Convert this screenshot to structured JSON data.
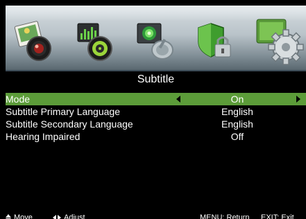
{
  "menu_icons": [
    {
      "name": "picture-icon",
      "active": false
    },
    {
      "name": "sound-icon",
      "active": false
    },
    {
      "name": "channel-icon",
      "active": false
    },
    {
      "name": "lock-icon",
      "active": false
    },
    {
      "name": "setup-gear-icon",
      "active": true
    }
  ],
  "page": {
    "title": "Subtitle"
  },
  "options": [
    {
      "label": "Mode",
      "value": "On",
      "selected": true
    },
    {
      "label": "Subtitle Primary Language",
      "value": "English",
      "selected": false
    },
    {
      "label": "Subtitle Secondary Language",
      "value": "English",
      "selected": false
    },
    {
      "label": "Hearing Impaired",
      "value": "Off",
      "selected": false
    }
  ],
  "footer": {
    "move": "Move",
    "adjust": "Adjust",
    "menu_return": "MENU: Return",
    "exit": "EXIT: Exit"
  },
  "colors": {
    "highlight": "#5c9c39",
    "background": "#000000",
    "text": "#ffffff"
  }
}
